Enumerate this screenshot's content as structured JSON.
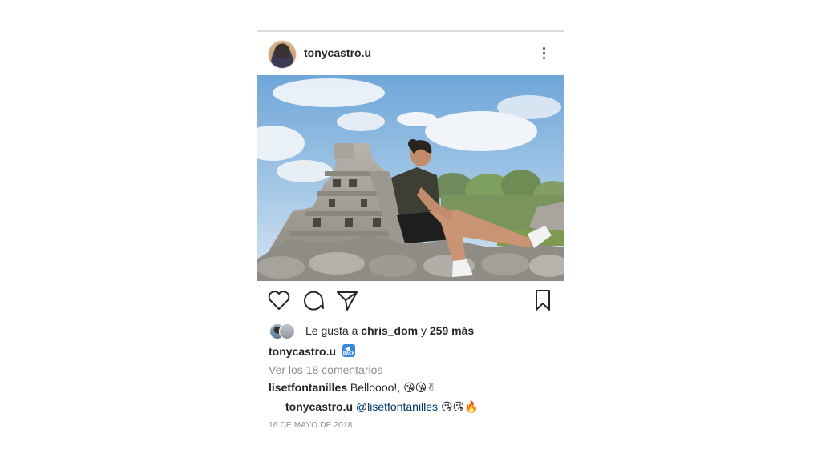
{
  "post": {
    "username": "tonycastro.u",
    "more_icon": "more-vertical-icon",
    "photo_icon": "pyramid-photo"
  },
  "actions": {
    "like_icon": "heart-icon",
    "comment_icon": "comment-icon",
    "share_icon": "send-icon",
    "save_icon": "bookmark-icon"
  },
  "likes": {
    "prefix": "Le gusta a ",
    "user": "chris_dom",
    "connector": " y ",
    "count": "259 más"
  },
  "caption": {
    "username": "tonycastro.u",
    "emoji": "🔙"
  },
  "view_comments": "Ver los 18 comentarios",
  "comments": [
    {
      "username": "lisetfontanilles",
      "text": "Belloooo!, 😘😘✌"
    },
    {
      "username": "tonycastro.u",
      "mention": "@lisetfontanilles",
      "text": "😘😘🔥"
    }
  ],
  "date": "16 DE MAYO DE 2018",
  "colors": {
    "text": "#262626",
    "muted": "#8e8e8e",
    "mention": "#003569"
  }
}
